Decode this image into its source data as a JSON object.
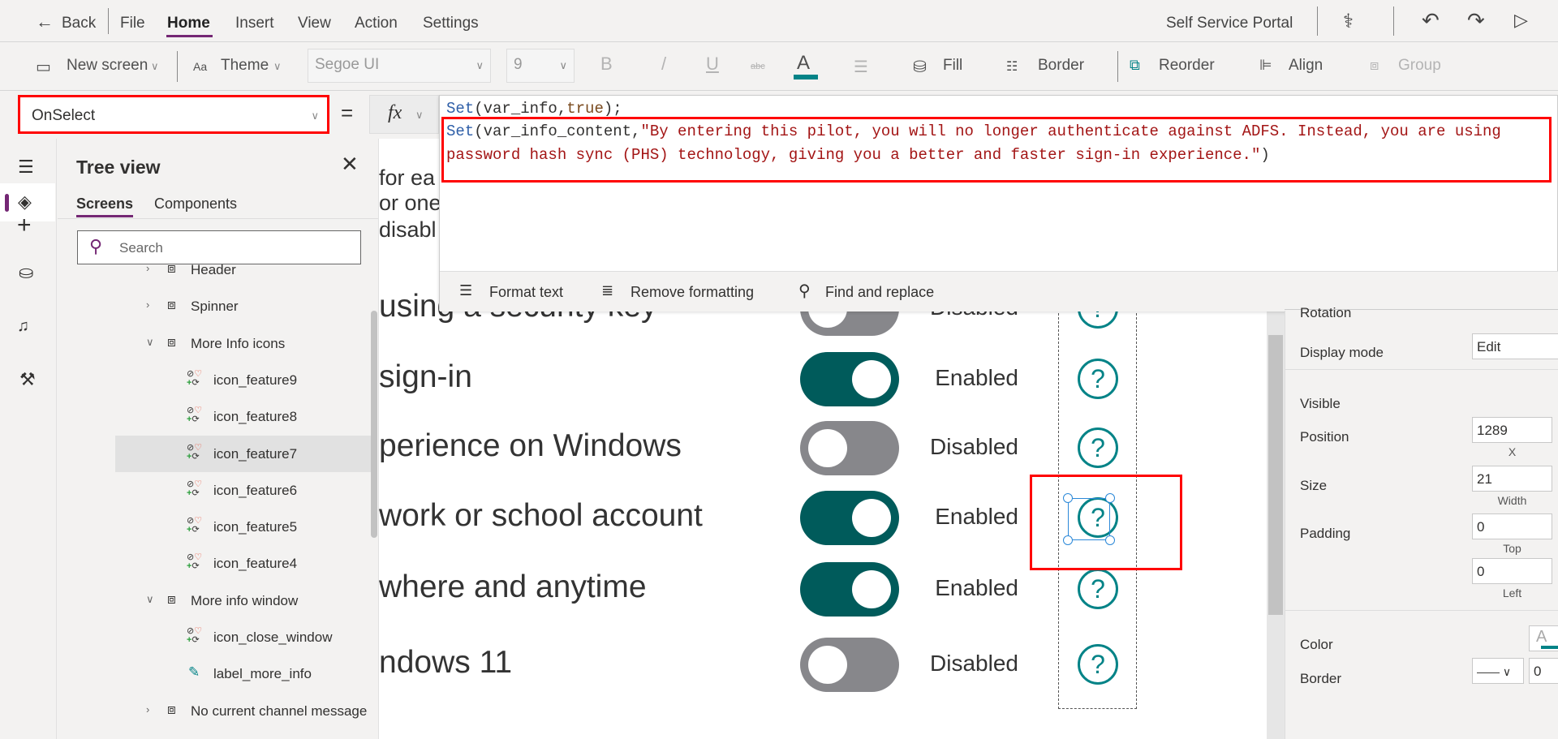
{
  "menu": {
    "back": "Back",
    "items": [
      "File",
      "Home",
      "Insert",
      "View",
      "Action",
      "Settings"
    ],
    "active": "Home",
    "app_name": "Self Service Portal"
  },
  "toolbar": {
    "new_screen": "New screen",
    "theme": "Theme",
    "font": "Segoe UI",
    "font_size": "9",
    "bold": "B",
    "italic": "/",
    "underline": "U",
    "strike": "abc",
    "font_color": "A",
    "fill": "Fill",
    "border": "Border",
    "reorder": "Reorder",
    "align": "Align",
    "group": "Group"
  },
  "formula": {
    "property": "OnSelect",
    "equals": "=",
    "fx": "fx",
    "line1": {
      "fn": "Set",
      "args": "(var_info,",
      "kw": "true",
      "end": ");"
    },
    "line2": {
      "fn": "Set",
      "args": "(var_info_content,",
      "str": "\"By entering this pilot, you will no longer authenticate against ADFS. Instead, you are using"
    },
    "line3": {
      "str": "password hash sync (PHS) technology, giving you a better and faster sign-in experience.\"",
      "end": ")"
    },
    "format_text": "Format text",
    "remove_formatting": "Remove formatting",
    "find_replace": "Find and replace"
  },
  "tree": {
    "title": "Tree view",
    "tabs": [
      "Screens",
      "Components"
    ],
    "search_placeholder": "Search",
    "items": [
      {
        "label": "Header",
        "type": "group"
      },
      {
        "label": "Spinner",
        "type": "group"
      },
      {
        "label": "More Info icons",
        "type": "group"
      },
      {
        "label": "icon_feature9",
        "type": "icon"
      },
      {
        "label": "icon_feature8",
        "type": "icon"
      },
      {
        "label": "icon_feature7",
        "type": "icon",
        "selected": true
      },
      {
        "label": "icon_feature6",
        "type": "icon"
      },
      {
        "label": "icon_feature5",
        "type": "icon"
      },
      {
        "label": "icon_feature4",
        "type": "icon"
      },
      {
        "label": "More info window",
        "type": "group"
      },
      {
        "label": "icon_close_window",
        "type": "icon"
      },
      {
        "label": "label_more_info",
        "type": "label"
      },
      {
        "label": "No current channel message",
        "type": "group"
      }
    ],
    "more": "..."
  },
  "canvas": {
    "intro": [
      "for ea",
      "or one",
      "disabl"
    ],
    "rows": [
      {
        "text": "using a security key",
        "status": "Disabled",
        "on": false
      },
      {
        "text": "sign-in",
        "status": "Enabled",
        "on": true
      },
      {
        "text": "perience on Windows",
        "status": "Disabled",
        "on": false
      },
      {
        "text": "work or school account",
        "status": "Enabled",
        "on": true
      },
      {
        "text": "where and anytime",
        "status": "Enabled",
        "on": true
      },
      {
        "text": "ndows 11",
        "status": "Disabled",
        "on": false
      }
    ],
    "help": "?"
  },
  "properties": {
    "rotation": "Rotation",
    "display_mode": "Display mode",
    "display_mode_value": "Edit",
    "visible": "Visible",
    "position": "Position",
    "x_value": "1289",
    "x_label": "X",
    "size": "Size",
    "width_value": "21",
    "width_label": "Width",
    "padding": "Padding",
    "top_value": "0",
    "top_label": "Top",
    "left_value": "0",
    "left_label": "Left",
    "color": "Color",
    "color_glyph": "A",
    "border": "Border",
    "border_width": "0"
  },
  "colors": {
    "accent": "#742774",
    "toggle_on": "#005b5b",
    "toggle_off": "#87878b",
    "help_icon": "#038387",
    "highlight": "#ff0000",
    "code_string": "#a31515",
    "code_keyword": "#2f5fa8"
  }
}
